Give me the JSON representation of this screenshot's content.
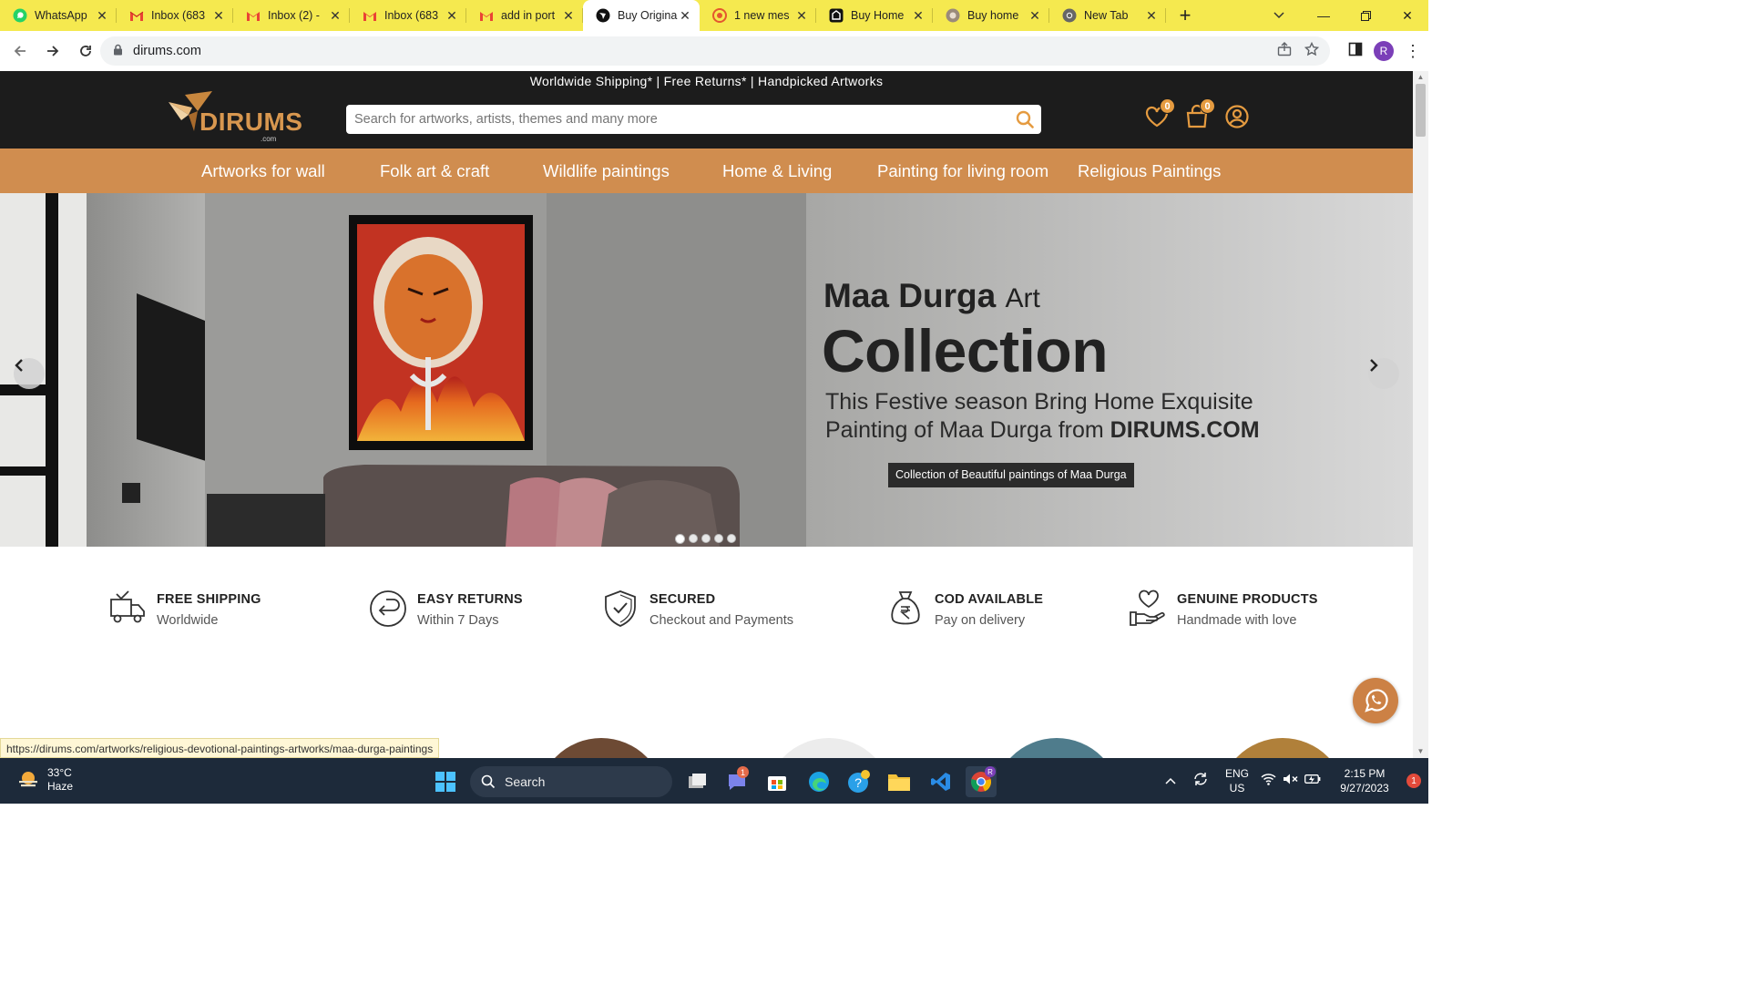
{
  "browser": {
    "tabs": [
      {
        "title": "WhatsApp",
        "icon": "whatsapp-icon",
        "active": false
      },
      {
        "title": "Inbox (683",
        "icon": "gmail-icon",
        "active": false
      },
      {
        "title": "Inbox (2) -",
        "icon": "gmail-icon",
        "active": false
      },
      {
        "title": "Inbox (683",
        "icon": "gmail-icon",
        "active": false
      },
      {
        "title": "add in port",
        "icon": "gmail-icon",
        "active": false
      },
      {
        "title": "Buy Origina",
        "icon": "dirums-icon",
        "active": true
      },
      {
        "title": "1 new mes",
        "icon": "message-icon",
        "active": false
      },
      {
        "title": "Buy Home",
        "icon": "shop-icon",
        "active": false
      },
      {
        "title": "Buy home",
        "icon": "shop-alt-icon",
        "active": false
      },
      {
        "title": "New Tab",
        "icon": "chrome-icon",
        "active": false
      }
    ],
    "url": "dirums.com",
    "profile_initial": "R",
    "status_url": "https://dirums.com/artworks/religious-devotional-paintings-artworks/maa-durga-paintings"
  },
  "site": {
    "promo": "Worldwide Shipping* | Free Returns* | Handpicked Artworks",
    "logo_text": "DIRUMS",
    "logo_sub": ".com",
    "search_placeholder": "Search for artworks, artists, themes and many more",
    "wishlist_count": "0",
    "cart_count": "0",
    "categories": [
      "Artworks for wall",
      "Folk art & craft",
      "Wildlife paintings",
      "Home & Living",
      "Painting for living room",
      "Religious Paintings"
    ]
  },
  "hero": {
    "title_bold": "Maa Durga",
    "title_light": "Art",
    "headline": "Collection",
    "sub_line1": "This Festive season Bring Home Exquisite",
    "sub_line2_pre": "Painting of Maa Durga from ",
    "sub_line2_brand": "DIRUMS.COM",
    "caption": "Collection of Beautiful paintings of Maa Durga",
    "slide_count": 5,
    "active_slide": 1
  },
  "features": [
    {
      "title": "FREE SHIPPING",
      "sub": "Worldwide",
      "icon": "delivery-truck-icon"
    },
    {
      "title": "EASY RETURNS",
      "sub": "Within 7 Days",
      "icon": "return-arrow-icon"
    },
    {
      "title": "SECURED",
      "sub": "Checkout and Payments",
      "icon": "shield-check-icon"
    },
    {
      "title": "COD AVAILABLE",
      "sub": "Pay on delivery",
      "icon": "rupee-bag-icon"
    },
    {
      "title": "GENUINE PRODUCTS",
      "sub": "Handmade with love",
      "icon": "heart-hand-icon"
    }
  ],
  "taskbar": {
    "temp": "33°C",
    "weather": "Haze",
    "search": "Search",
    "lang_line1": "ENG",
    "lang_line2": "US",
    "time": "2:15 PM",
    "date": "9/27/2023",
    "teams_badge": "1",
    "notification_count": "1"
  },
  "colors": {
    "tab_strip": "#f5e94f",
    "site_dark": "#1c1c1c",
    "accent": "#d08d4f",
    "badge": "#e59b40"
  }
}
